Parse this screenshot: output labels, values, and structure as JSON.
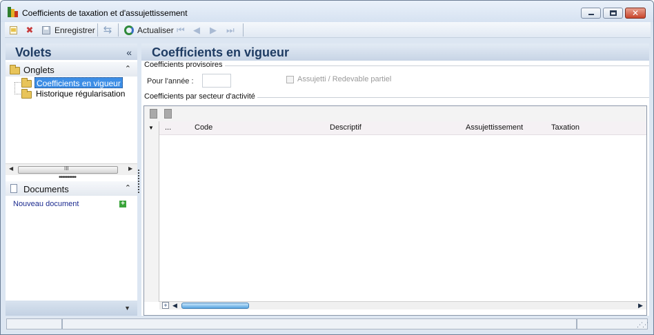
{
  "window": {
    "title": "Coefficients de taxation et d'assujettissement",
    "controls": [
      "minimize",
      "maximize",
      "close"
    ]
  },
  "toolbar": {
    "save_label": "Enregistrer",
    "refresh_label": "Actualiser",
    "icons": [
      "new-icon",
      "delete-icon",
      "save-icon",
      "sync-icon",
      "refresh-icon",
      "first-icon",
      "prev-icon",
      "next-icon",
      "last-icon"
    ]
  },
  "sidebar": {
    "title": "Volets",
    "collapse_glyph": "«",
    "onglets": {
      "title": "Onglets",
      "toggle_glyph": "⌃",
      "items": [
        {
          "label": "Coefficients en vigueur",
          "selected": true
        },
        {
          "label": "Historique régularisation",
          "selected": false
        }
      ],
      "scroll_glyph": "III"
    },
    "documents": {
      "title": "Documents",
      "toggle_glyph": "⌃",
      "new_doc_label": "Nouveau document"
    }
  },
  "main": {
    "title": "Coefficients en vigueur",
    "provisional": {
      "title": "Coefficients provisoires",
      "year_label": "Pour l'année :",
      "year_value": "",
      "checkbox_label": "Assujetti / Redevable partiel",
      "checkbox_checked": false
    },
    "sector": {
      "title": "Coefficients par secteur d'activité",
      "columns": [
        "...",
        "Code",
        "Descriptif",
        "Assujettissement",
        "Taxation"
      ],
      "rows": []
    }
  },
  "colors": {
    "header_text": "#1f3c63",
    "selection": "#3d8ee6",
    "link": "#1b2a8f"
  }
}
